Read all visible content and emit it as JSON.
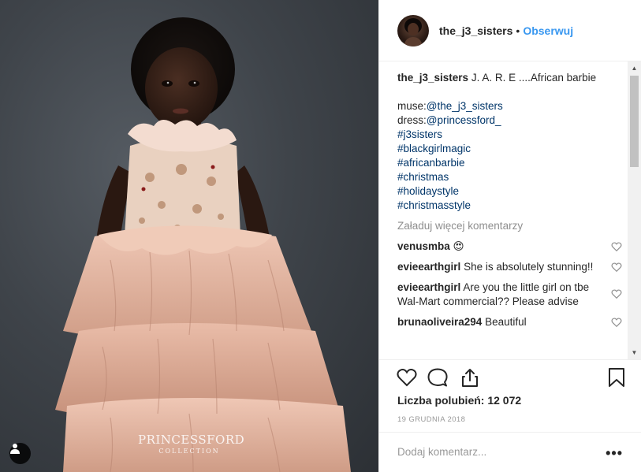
{
  "post": {
    "watermark_main": "PRINCESSFORD",
    "watermark_sub": "COLLECTION"
  },
  "header": {
    "username": "the_j3_sisters",
    "separator": "•",
    "follow_label": "Obserwuj"
  },
  "caption": {
    "username": "the_j3_sisters",
    "text": "J. A. R. E ....African barbie",
    "muse_prefix": "muse:",
    "muse_link": "@the_j3_sisters",
    "dress_prefix": "dress:",
    "dress_link": "@princessford_",
    "hashtags": [
      "#j3sisters",
      "#blackgirlmagic",
      "#africanbarbie",
      "#christmas",
      "#holidaystyle",
      "#christmasstyle"
    ]
  },
  "load_more_label": "Załaduj więcej komentarzy",
  "comments": [
    {
      "user": "venusmba",
      "text": "😍"
    },
    {
      "user": "evieearthgirl",
      "text": "She is absolutely stunning!!"
    },
    {
      "user": "evieearthgirl",
      "text": "Are you the little girl on tbe Wal-Mart commercial?? Please advise"
    },
    {
      "user": "brunaoliveira294",
      "text": "Beautiful"
    }
  ],
  "likes_label": "Liczba polubień: 12 072",
  "date_label": "19 GRUDNIA 2018",
  "add_comment_placeholder": "Dodaj komentarz...",
  "more_label": "•••",
  "icons": {
    "like": "heart-icon",
    "comment": "comment-icon",
    "share": "share-icon",
    "save": "bookmark-icon",
    "user_tag": "user-icon"
  },
  "colors": {
    "link": "#003569",
    "follow": "#3897f0",
    "muted": "#8e8e8e"
  }
}
